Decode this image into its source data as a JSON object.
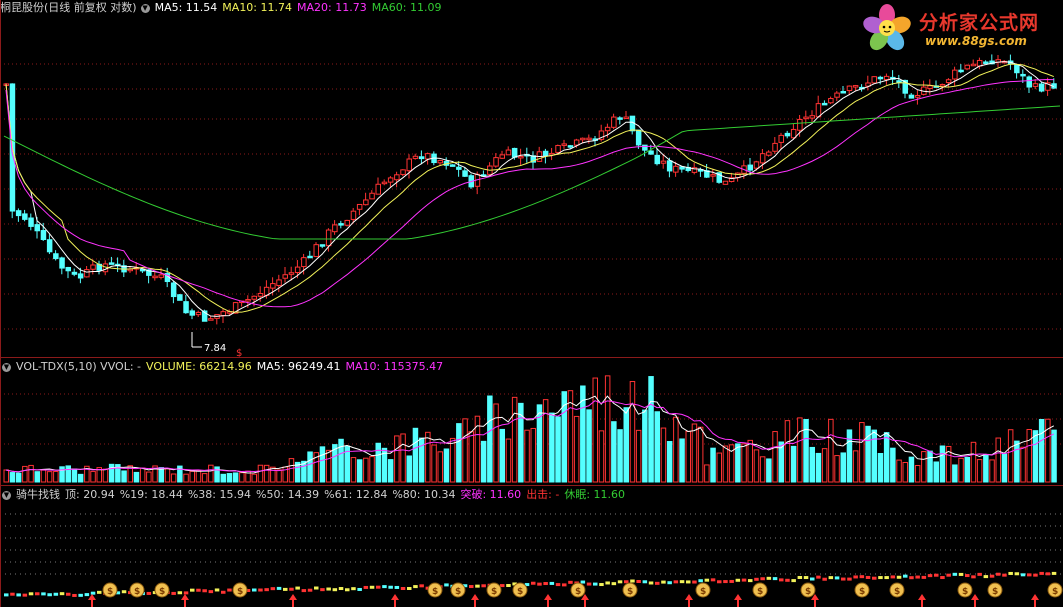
{
  "main_panel": {
    "stock_name": "桐昆股份(日线 前复权 对数)",
    "indicators": [
      {
        "label": "MA5: 11.54",
        "color": "#ffffff"
      },
      {
        "label": "MA10: 11.74",
        "color": "#f2f25a"
      },
      {
        "label": "MA20: 11.73",
        "color": "#ff33ff"
      },
      {
        "label": "MA60: 11.09",
        "color": "#33cc33"
      }
    ],
    "low_marker": "7.84",
    "dollar_marker": "$"
  },
  "logo": {
    "title": "分析家公式网",
    "url": "www.88gs.com"
  },
  "volume_panel": {
    "name": "VOL-TDX(5,10) VVOL: -",
    "indicators": [
      {
        "label": "VOLUME: 66214.96",
        "color": "#f2f25a"
      },
      {
        "label": "MA5: 96249.41",
        "color": "#ffffff"
      },
      {
        "label": "MA10: 115375.47",
        "color": "#ff33ff"
      }
    ]
  },
  "bull_panel": {
    "name": "骑牛找钱",
    "indicators": [
      {
        "label": "顶: 20.94",
        "color": "#d0d0d0"
      },
      {
        "label": "%19: 18.44",
        "color": "#d0d0d0"
      },
      {
        "label": "%38: 15.94",
        "color": "#d0d0d0"
      },
      {
        "label": "%50: 14.39",
        "color": "#d0d0d0"
      },
      {
        "label": "%61: 12.84",
        "color": "#d0d0d0"
      },
      {
        "label": "%80: 10.34",
        "color": "#d0d0d0"
      },
      {
        "label": "突破: 11.60",
        "color": "#ff33ff"
      },
      {
        "label": "出击: -",
        "color": "#ff3333"
      },
      {
        "label": "休眠: 11.60",
        "color": "#33cc33"
      }
    ]
  },
  "colors": {
    "up": "#ff3333",
    "down": "#54ffff",
    "ma5": "#ffffff",
    "ma10": "#f2f25a",
    "ma20": "#ff33ff",
    "ma60": "#33cc33",
    "grid": "#8b1a1a"
  }
}
